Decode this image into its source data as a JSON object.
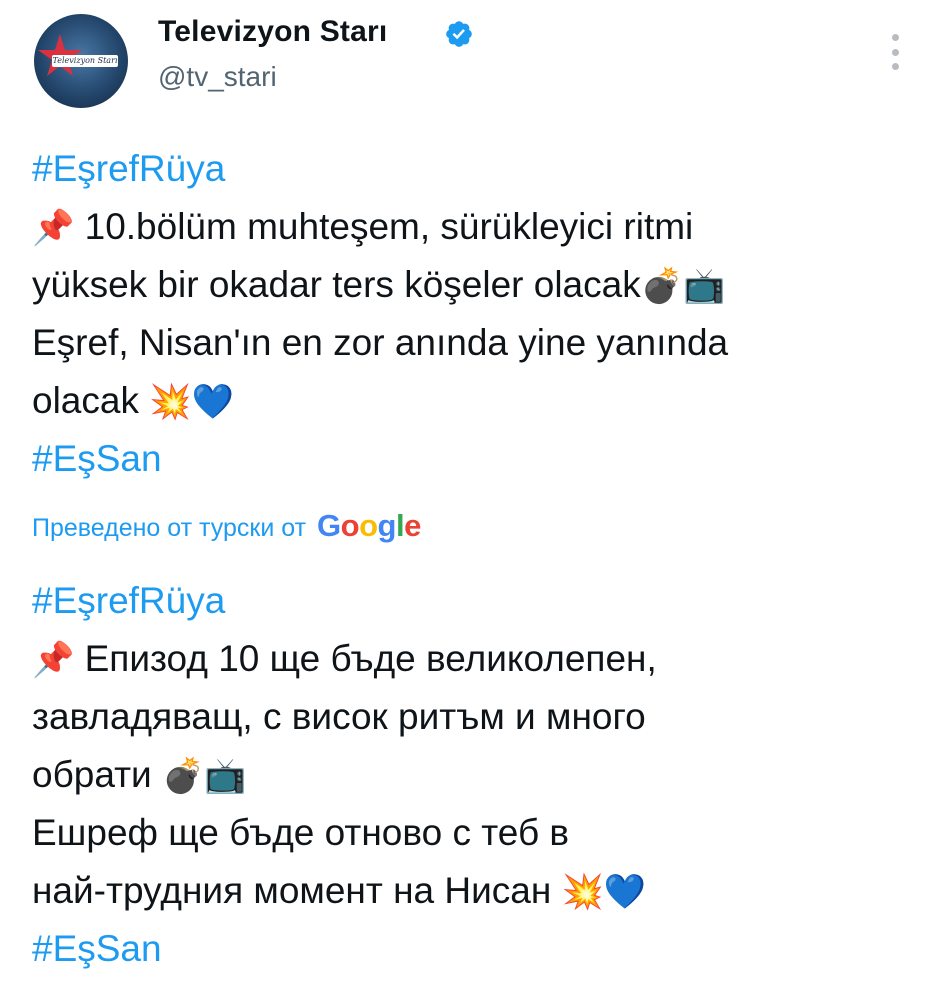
{
  "header": {
    "display_name": "Televizyon Starı",
    "handle": "@tv_stari",
    "avatar_logo_text": "Televizyon Starı",
    "verified_icon": "verified-badge-icon",
    "more_icon": "more-vertical-icon"
  },
  "tweet": {
    "hashtag_top": "#EşrefRüya",
    "line1_emoji": "📌",
    "line1_text": "10.bölüm muhteşem, sürükleyici ritmi",
    "line2_text": "yüksek bir okadar ters köşeler olacak",
    "line2_emoji": "💣📺",
    "line3_text": "Eşref, Nisan'ın en zor anında yine yanında",
    "line4_text": "olacak ",
    "line4_emoji": "💥💙",
    "hashtag_bottom": "#EşSan"
  },
  "translation": {
    "label": "Преведено от турски от",
    "provider": "Google"
  },
  "translated_tweet": {
    "hashtag_top": "#EşrefRüya",
    "line1_emoji": "📌",
    "line1_text": " Епизод 10 ще бъде великолепен,",
    "line2_text": "завладяващ, с висок ритъм и много",
    "line3_text": "обрати ",
    "line3_emoji": "💣📺",
    "line4_text": "Ешреф ще бъде отново с теб в",
    "line5_text": "най-трудния момент на Нисан ",
    "line5_emoji": "💥💙",
    "hashtag_bottom": "#EşSan"
  },
  "colors": {
    "link_blue": "#1d9bf0",
    "text": "#0f1419",
    "secondary_text": "#536471"
  }
}
